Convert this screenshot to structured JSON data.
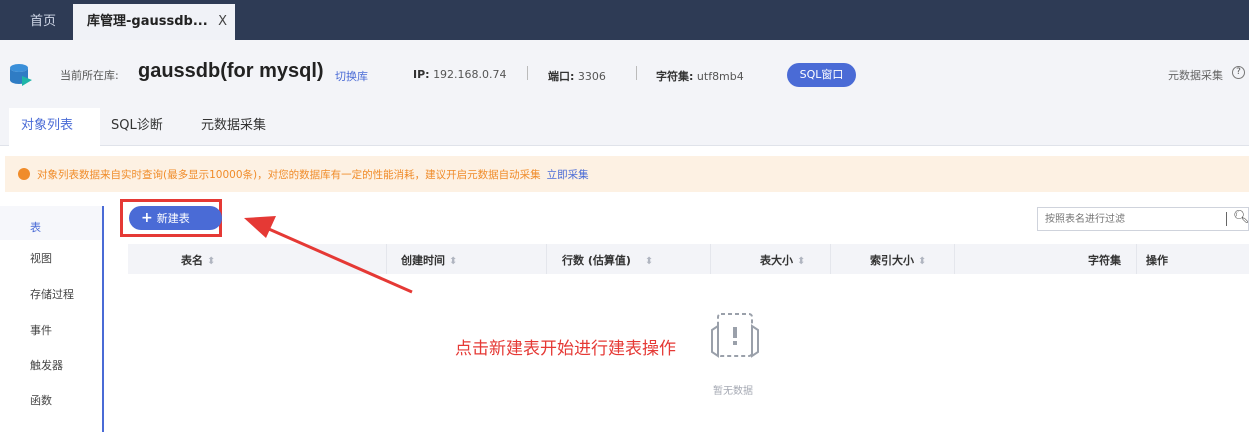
{
  "tabs": {
    "home": "首页",
    "active": "库管理-gaussdb...",
    "close": "X"
  },
  "db": {
    "current_label": "当前所在库:",
    "name": "gaussdb(for mysql)",
    "switch": "切换库",
    "ip_label": "IP:",
    "ip": "192.168.0.74",
    "port_label": "端口:",
    "port": "3306",
    "charset_label": "字符集:",
    "charset": "utf8mb4",
    "sql_window": "SQL窗口",
    "meta_collect": "元数据采集",
    "help": "?"
  },
  "subtabs": [
    "对象列表",
    "SQL诊断",
    "元数据采集"
  ],
  "banner": {
    "text": "对象列表数据来自实时查询(最多显示10000条)，对您的数据库有一定的性能消耗，建议开启元数据自动采集",
    "link": "立即采集"
  },
  "sidenav": [
    "表",
    "视图",
    "存储过程",
    "事件",
    "触发器",
    "函数"
  ],
  "toolbar": {
    "new_table": "新建表",
    "filter_placeholder": "按照表名进行过滤"
  },
  "table": {
    "columns": [
      "表名",
      "创建时间",
      "行数 (估算值)",
      "表大小",
      "索引大小",
      "字符集",
      "操作"
    ],
    "empty": "暂无数据"
  },
  "annotation": "点击新建表开始进行建表操作",
  "colors": {
    "accent": "#4a6bd6",
    "topbar": "#2e3b55",
    "warning": "#f08c2a",
    "annotation": "#e53935"
  }
}
